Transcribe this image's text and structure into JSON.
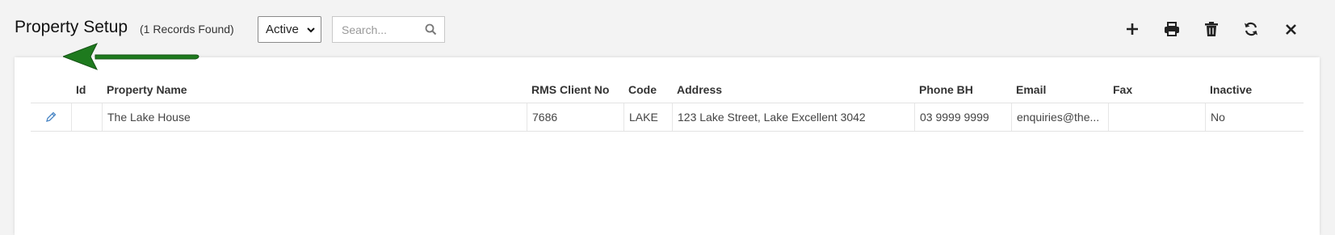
{
  "header": {
    "title": "Property Setup",
    "records": "(1 Records Found)",
    "status_filter": {
      "selected": "Active"
    },
    "search": {
      "placeholder": "Search...",
      "value": ""
    }
  },
  "toolbar": {
    "icons": [
      "plus-icon",
      "print-icon",
      "trash-icon",
      "refresh-icon",
      "close-icon"
    ]
  },
  "table": {
    "columns": [
      "",
      "Id",
      "Property Name",
      "RMS Client No",
      "Code",
      "Address",
      "Phone BH",
      "Email",
      "Fax",
      "Inactive"
    ],
    "rows": [
      {
        "id": "",
        "property_name": "The Lake House",
        "rms_client_no": "7686",
        "code": "LAKE",
        "address": "123 Lake Street, Lake Excellent 3042",
        "phone_bh": "03 9999 9999",
        "email": "enquiries@the...",
        "fax": "",
        "inactive": "No"
      }
    ]
  },
  "colors": {
    "accent": "#2b6cb0",
    "arrow": "#1e7a1e",
    "edit_icon": "#4a86c5"
  }
}
